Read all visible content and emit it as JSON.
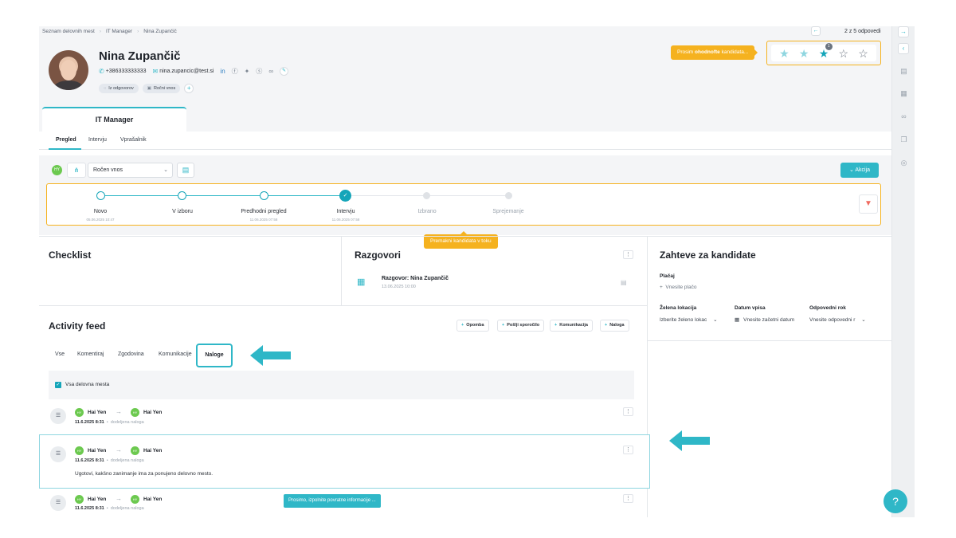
{
  "breadcrumb": [
    "Seznam delovnih mest",
    "IT Manager",
    "Nina Zupančič"
  ],
  "pager": {
    "prev": "←",
    "text": "2 z 5 odpovedi"
  },
  "candidate": {
    "name": "Nina Zupančič",
    "phone": "+386333333333",
    "email": "nina.zupancic@test.si",
    "tags": [
      "Iz odgovorov",
      "Ročni vnos"
    ]
  },
  "rating": {
    "tooltip_prefix": "Prosim ",
    "tooltip_bold": "ohodnofte",
    "tooltip_suffix": " kandidata...",
    "badge": "1"
  },
  "job_tab": "IT Manager",
  "subtabs": [
    "Pregled",
    "Intervju",
    "Vprašalnik"
  ],
  "pipeline_controls": {
    "source_value": "Ročen vnos",
    "action_label": "Akcija",
    "avatar_initials": "HY"
  },
  "pipeline": [
    {
      "label": "Novo",
      "date": "05.06.2025 10:47",
      "state": "done-line"
    },
    {
      "label": "V izboru",
      "date": "",
      "state": "done-line"
    },
    {
      "label": "Predhodni pregled",
      "date": "11.06.2025 07:58",
      "state": "done-line"
    },
    {
      "label": "Intervju",
      "date": "11.06.2025 07:58",
      "state": "current"
    },
    {
      "label": "Izbrano",
      "date": "",
      "state": "todo"
    },
    {
      "label": "Sprejemanje",
      "date": "",
      "state": "todo"
    }
  ],
  "pipeline_tooltip": "Premakni kandidata v toku",
  "checklist": {
    "title": "Checklist"
  },
  "razgovori": {
    "title": "Razgovori",
    "item_title": "Razgovor: Nina Zupančič",
    "item_date": "13.06.2025 10:00"
  },
  "zahteve": {
    "title": "Zahteve za kandidate",
    "placa_label": "Plačaj",
    "placa_add": "Vnesite plačo",
    "lokacija_label": "Želena lokacija",
    "lokacija_placeholder": "Izberite želeno lokac",
    "datum_label": "Datum vpisa",
    "datum_placeholder": "Vnesite začetni datum",
    "rok_label": "Odpovedni rok",
    "rok_placeholder": "Vnesite odpovedni r"
  },
  "activity": {
    "title": "Activity feed",
    "buttons": [
      "Opomba",
      "Pošlji sporočilo",
      "Komunikacija",
      "Naloga"
    ],
    "tabs": [
      "Vse",
      "Komentiraj",
      "Zgodovina",
      "Komunikacije",
      "Naloge"
    ],
    "filter_label": "Vsa delovna mesta",
    "items": [
      {
        "from": "Hai Yen",
        "to": "Hai Yen",
        "time": "11.6.2025 8:31",
        "kind": "dodeljena naloga",
        "text": ""
      },
      {
        "from": "Hai Yen",
        "to": "Hai Yen",
        "time": "11.6.2025 8:31",
        "kind": "dodeljena naloga",
        "text": "Ugotovi, kakšno zanimanje ima za ponujeno delovno mesto."
      },
      {
        "from": "Hai Yen",
        "to": "Hai Yen",
        "time": "11.6.2025 8:31",
        "kind": "dodeljena naloga",
        "text": ""
      }
    ],
    "initials": "HY",
    "bottom_tooltip": "Prosimo, izpolnite povratne informacije ..."
  },
  "help": "?",
  "colors": {
    "accent": "#2fb7c7",
    "warning": "#f5b21f",
    "success": "#6cc94f"
  }
}
